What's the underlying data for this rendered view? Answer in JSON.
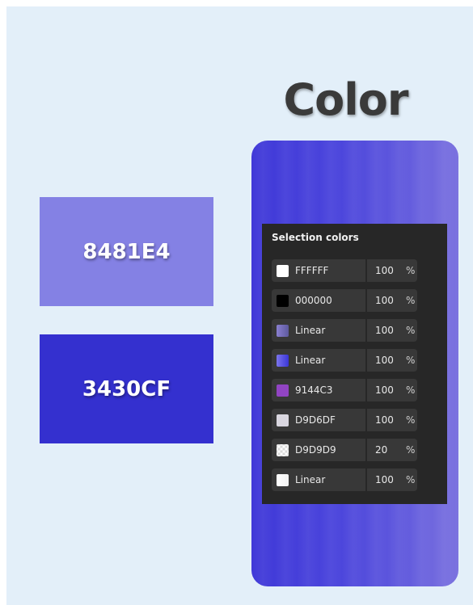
{
  "title": "Color",
  "swatches": [
    {
      "label": "8481E4",
      "color": "#8481E4"
    },
    {
      "label": "3430CF",
      "color": "#3430CF"
    }
  ],
  "panel": {
    "title": "Selection colors",
    "rows": [
      {
        "name": "FFFFFF",
        "opacity": "100",
        "unit": "%",
        "chip": "#FFFFFF"
      },
      {
        "name": "000000",
        "opacity": "100",
        "unit": "%",
        "chip": "#000000"
      },
      {
        "name": "Linear",
        "opacity": "100",
        "unit": "%",
        "chip": "linear-gradient(90deg,#8a7fd0,#5e5a9e)"
      },
      {
        "name": "Linear",
        "opacity": "100",
        "unit": "%",
        "chip": "linear-gradient(90deg,#7b74ec,#3a35d6)"
      },
      {
        "name": "9144C3",
        "opacity": "100",
        "unit": "%",
        "chip": "#9144C3"
      },
      {
        "name": "D9D6DF",
        "opacity": "100",
        "unit": "%",
        "chip": "#D9D6DF"
      },
      {
        "name": "D9D9D9",
        "opacity": "20",
        "unit": "%",
        "chip": "repeating-conic-gradient(#d9d9d9 0% 25%, #ffffff 0% 50%) 50% / 6px 6px"
      },
      {
        "name": "Linear",
        "opacity": "100",
        "unit": "%",
        "chip": "linear-gradient(90deg,#ffffff,#f2f2f2)"
      }
    ]
  }
}
